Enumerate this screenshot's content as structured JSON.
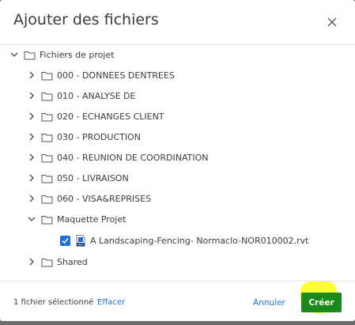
{
  "dialog": {
    "title": "Ajouter des fichiers",
    "close_icon": "close-icon"
  },
  "tree": {
    "root": {
      "label": "Fichiers de projet",
      "expanded": true
    },
    "folders": [
      {
        "label": "000 - DONNEES DENTREES",
        "expanded": false
      },
      {
        "label": "010 - ANALYSE DE",
        "expanded": false
      },
      {
        "label": "020 - ECHANGES CLIENT",
        "expanded": false
      },
      {
        "label": "030 - PRODUCTION",
        "expanded": false
      },
      {
        "label": "040 - REUNION DE COORDINATION",
        "expanded": false
      },
      {
        "label": "050 - LIVRAISON",
        "expanded": false
      },
      {
        "label": "060 - VISA&REPRISES",
        "expanded": false
      },
      {
        "label": "Maquette Projet",
        "expanded": true
      },
      {
        "label": "Shared",
        "expanded": false
      }
    ],
    "file": {
      "label": "A Landscaping-Fencing- Normaclo-NOR010002.rvt",
      "checked": true,
      "icon": "rvt-file-icon",
      "icon_text": "RVT"
    }
  },
  "footer": {
    "selection_text": "1 fichier sélectionné",
    "clear_label": "Effacer",
    "cancel_label": "Annuler",
    "create_label": "Créer"
  },
  "colors": {
    "accent": "#1e6fd9",
    "create_button": "#1a8a1a",
    "highlight": "#ffff33"
  }
}
